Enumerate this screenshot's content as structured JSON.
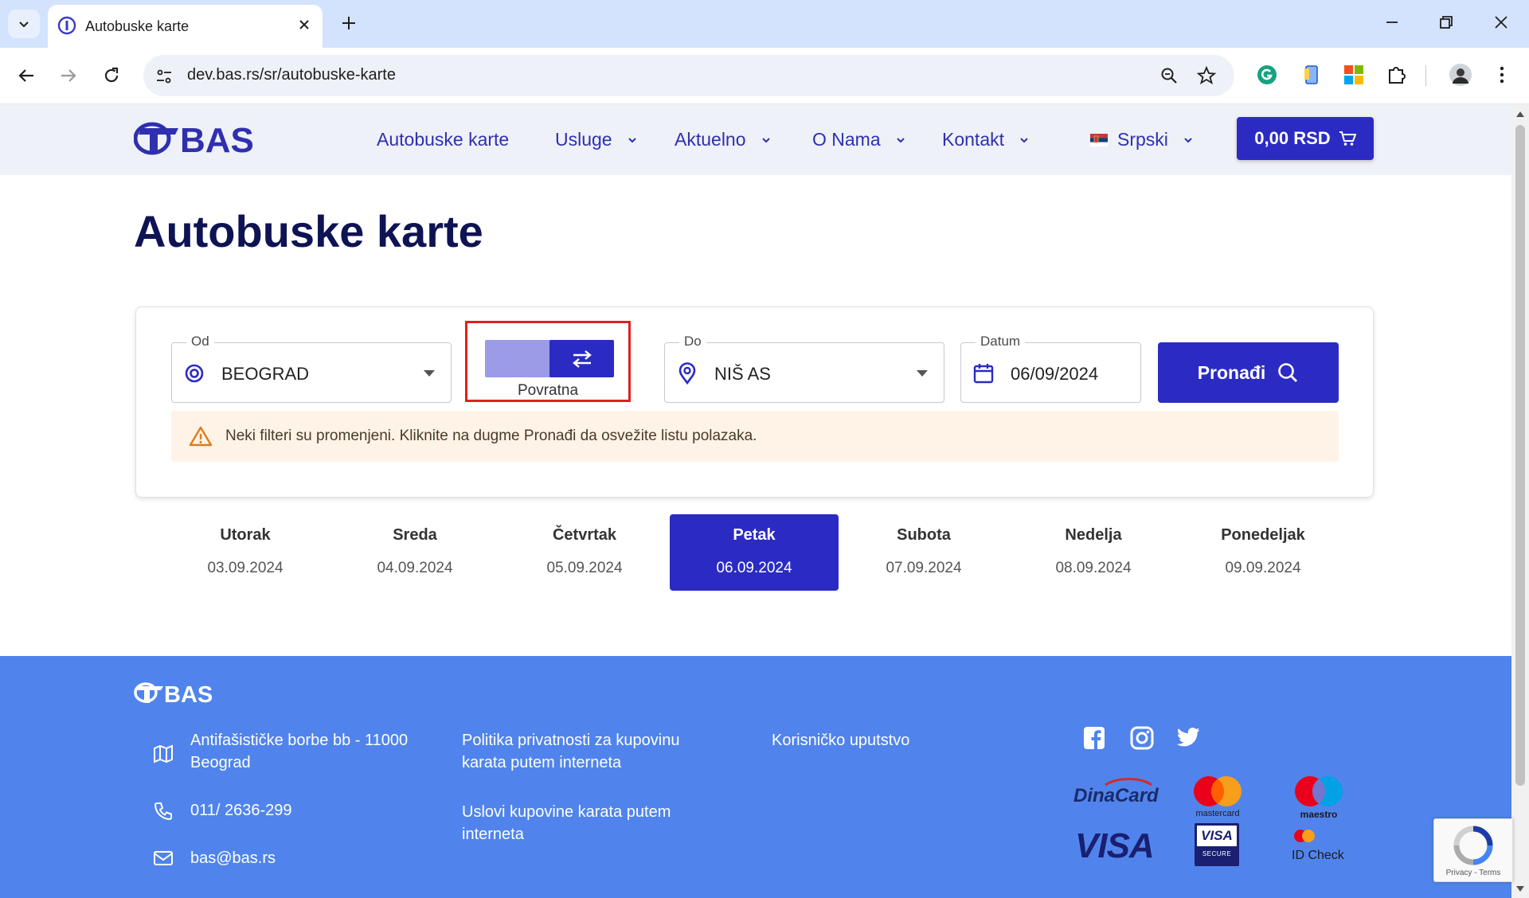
{
  "browser": {
    "tab_title": "Autobuske karte",
    "url": "dev.bas.rs/sr/autobuske-karte"
  },
  "header": {
    "logo_text": "BAS",
    "nav": [
      {
        "label": "Autobuske karte",
        "has_dropdown": false
      },
      {
        "label": "Usluge",
        "has_dropdown": true
      },
      {
        "label": "Aktuelno",
        "has_dropdown": true
      },
      {
        "label": "O Nama",
        "has_dropdown": true
      },
      {
        "label": "Kontakt",
        "has_dropdown": true
      }
    ],
    "language": "Srpski",
    "cart_total": "0,00 RSD"
  },
  "main": {
    "title": "Autobuske karte",
    "search": {
      "from_label": "Od",
      "from_value": "BEOGRAD",
      "return_label": "Povratna",
      "to_label": "Do",
      "to_value": "NIŠ AS",
      "date_label": "Datum",
      "date_value": "06/09/2024",
      "find_label": "Pronađi"
    },
    "alert": "Neki filteri su promenjeni. Kliknite na dugme Pronađi da osvežite listu polazaka.",
    "days": [
      {
        "name": "Utorak",
        "date": "03.09.2024",
        "active": false
      },
      {
        "name": "Sreda",
        "date": "04.09.2024",
        "active": false
      },
      {
        "name": "Četvrtak",
        "date": "05.09.2024",
        "active": false
      },
      {
        "name": "Petak",
        "date": "06.09.2024",
        "active": true
      },
      {
        "name": "Subota",
        "date": "07.09.2024",
        "active": false
      },
      {
        "name": "Nedelja",
        "date": "08.09.2024",
        "active": false
      },
      {
        "name": "Ponedeljak",
        "date": "09.09.2024",
        "active": false
      }
    ]
  },
  "footer": {
    "logo_text": "BAS",
    "address_line1": "Antifašističke borbe bb - 11000",
    "address_line2": "Beograd",
    "phone": "011/ 2636-299",
    "email": "bas@bas.rs",
    "privacy_line1": "Politika privatnosti za kupovinu",
    "privacy_line2": "karata putem interneta",
    "terms_line1": "Uslovi kupovine karata putem",
    "terms_line2": "interneta",
    "manual": "Korisničko uputstvo",
    "payments": {
      "dinacard": "DinaCard",
      "mastercard": "mastercard",
      "maestro": "maestro",
      "visa": "VISA",
      "visa_secure_top": "VISA",
      "visa_secure_bottom": "SECURE",
      "id_check": "ID Check"
    }
  },
  "recaptcha": "Privacy - Terms",
  "colors": {
    "brand_blue": "#2b2bc4",
    "nav_text": "#2f2fb0",
    "footer_bg": "#5084ec",
    "title": "#0e1353",
    "alert_bg": "#fef3e6",
    "highlight_border": "#e02020"
  }
}
